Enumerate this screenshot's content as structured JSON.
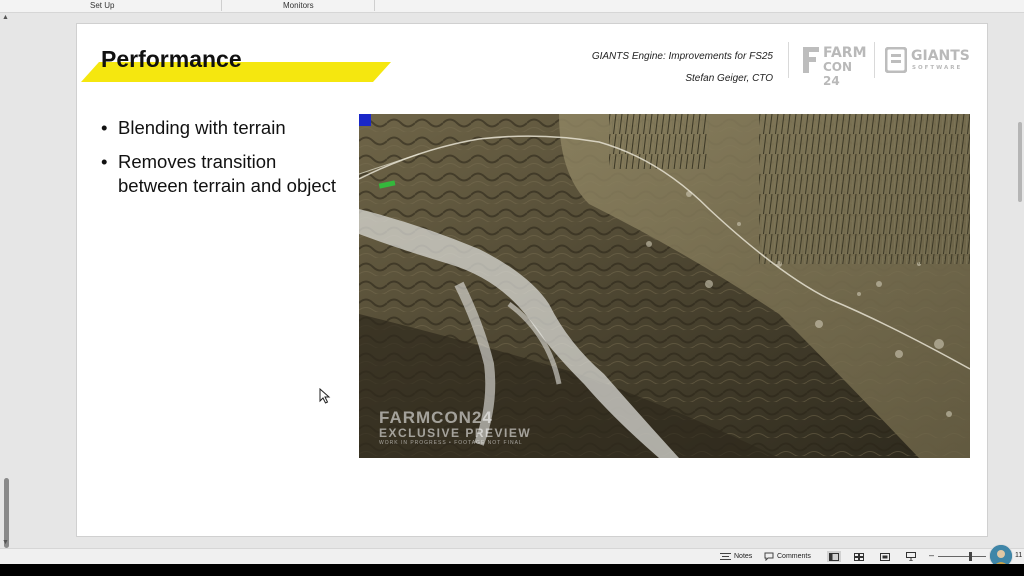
{
  "window": {
    "tabs": [
      "Set Up",
      "Monitors"
    ]
  },
  "slide": {
    "title": "Performance",
    "header": {
      "line1": "GIANTS Engine: Improvements for FS25",
      "line2": "Stefan Geiger, CTO"
    },
    "logos": {
      "farmcon": {
        "line1": "FARM",
        "line2": "CON 24"
      },
      "giants": {
        "name": "GIANTS",
        "sub": "SOFTWARE"
      }
    },
    "bullets": [
      "Blending with terrain",
      "Removes transition between terrain and object"
    ],
    "video_watermark": {
      "line1": "FARMCON24",
      "line2": "EXCLUSIVE PREVIEW",
      "line3": "WORK IN PROGRESS • FOOTAGE NOT FINAL"
    }
  },
  "statusbar": {
    "notes_label": "Notes",
    "comments_label": "Comments",
    "zoom_minus": "–",
    "zoom_plus": "+",
    "zoom_level": "11"
  },
  "colors": {
    "title_band": "#f5e70f",
    "slide_bg": "#ffffff",
    "app_bg": "#e6e6e6"
  }
}
